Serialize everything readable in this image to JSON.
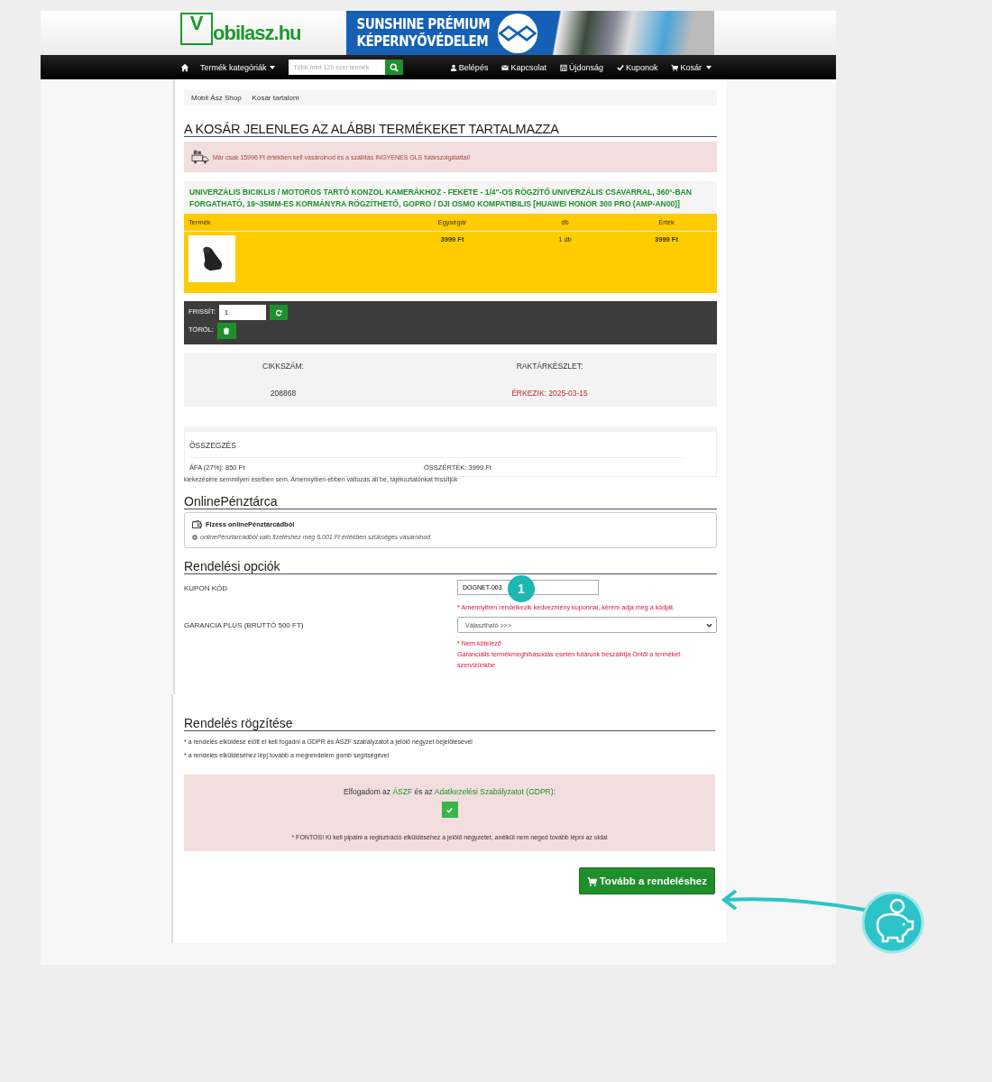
{
  "header": {
    "logo_letter": "V",
    "logo_text": "obilasz.hu",
    "banner_line1": "SUNSHINE PRÉMIUM",
    "banner_line2": "KÉPERNYŐVÉDELEM"
  },
  "nav": {
    "category_label": "Termék kategóriák",
    "search_placeholder": "Több mint 120 ezer termék",
    "right_items": [
      {
        "label": "Belépés"
      },
      {
        "label": "Kapcsolat"
      },
      {
        "label": "Újdonság"
      },
      {
        "label": "Kuponok"
      },
      {
        "label": "Kosár",
        "dropdown": true
      }
    ]
  },
  "breadcrumb": [
    "Mobil Ász Shop",
    "Kosár tartalom"
  ],
  "cart": {
    "title": "A KOSÁR JELENLEG AZ ALÁBBI TERMÉKEKET TARTALMAZZA",
    "shipping_notice": "Már csak 15996 Ft értékben kell vásárolnod és a szállítás INGYENES GLS futárszolgálattal!",
    "product_name": "UNIVERZÁLIS BICIKLIS / MOTOROS TARTÓ KONZOL KAMERÁKHOZ - FEKETE - 1/4\"-OS RÖGZÍTŐ UNIVERZÁLIS CSAVARRAL, 360°-BAN FORGATHATÓ, 19~35MM-ES KORMÁNYRA RÖGZÍTHETŐ, GOPRO / DJI OSMO KOMPATIBILIS [HUAWEI HONOR 300 PRO (AMP-AN00)]",
    "columns": [
      "Termék",
      "Egységár",
      "db",
      "Érték"
    ],
    "row": {
      "unit_price": "3999 Ft",
      "qty": "1 db",
      "value": "3999 Ft"
    },
    "update_label": "FRISSÍT:",
    "qty_value": "1",
    "delete_label": "TÖRÖL:",
    "sku_label": "CIKKSZÁM:",
    "sku": "208868",
    "stock_label": "RAKTÁRKÉSZLET:",
    "stock": "ÉRKEZIK: 2025-03-15"
  },
  "summary": {
    "title": "ÖSSZEGZÉS",
    "vat": "ÁFA (27%): 850 Ft",
    "total": "ÖSSZÉRTÉK: 3999 Ft",
    "hidden_note": "kiekezésére semmilyen esetben sem. Amennyiben ebben változás áll be, tájékoztatónkat frissítjük"
  },
  "wallet": {
    "title": "OnlinePénztárca",
    "option": "Fizess onlinePénztárcádból",
    "note": "onlinePénztárcádból való fizetéshez még 6.001 Ft értékben szükséges vásárolnod"
  },
  "options": {
    "title": "Rendelési opciók",
    "coupon_label": "KUPON KÓD",
    "coupon_value": "DOGNET-003",
    "coupon_hint": "* Amennyiben rendelkezik kedvezmény kuponnal, kérem adja meg a kódját.",
    "warranty_label": "GARANCIA PLUS (BRUTTÓ 500 FT)",
    "warranty_value": "Választható >>>",
    "warranty_hint1": "* Nem kötelező",
    "warranty_hint2": "Garanciális termékmeghibásodás esetén futárunk beszállítja Öntől a terméket szervizünkbe"
  },
  "order": {
    "title": "Rendelés rögzítése",
    "notes": [
      "* a rendelés elküldése előtt el kell fogadni a GDPR és ÁSZF szabályzatot a jelölő négyzet bejelölésével",
      "* a rendelés elküldéséhez lépj tovább a megrendelem gomb segítségével"
    ],
    "accept_prefix": "Elfogadom az",
    "aszf_link": "ÁSZF",
    "accept_mid": "és az",
    "gdpr_link": "Adatkezelési Szabályzatot (GDPR)",
    "accept_suffix": ":",
    "accepted": true,
    "important": "* FONTOS! Ki kell pipálni a regisztráció elküldéséhez a jelölő négyzetet, anélkül nem neged tovább lépni az oldal",
    "submit": "Tovább a rendeléshez"
  },
  "annotation": {
    "badge": "1"
  }
}
